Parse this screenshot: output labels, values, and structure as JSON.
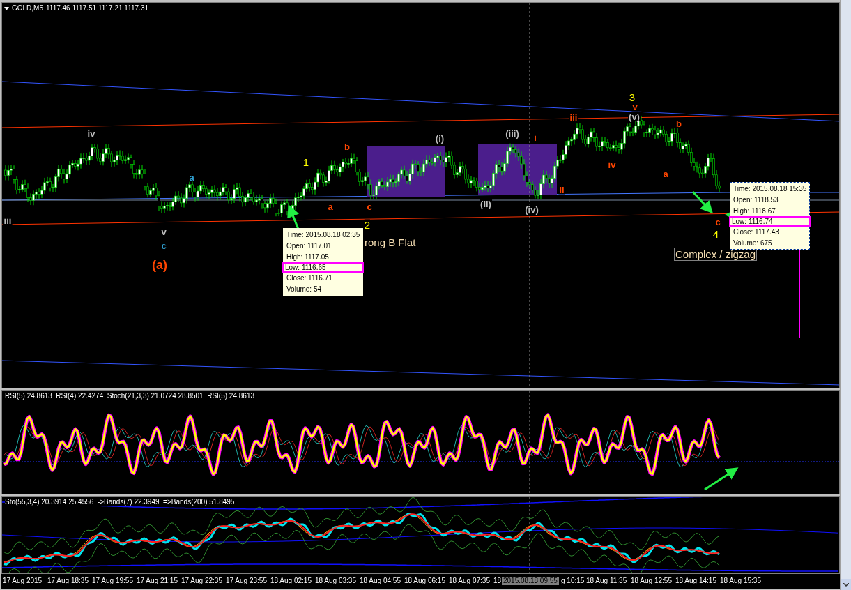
{
  "chart": {
    "symbol": "GOLD,M5",
    "ohlc": "1117.46 1117.51 1117.21 1117.31"
  },
  "wave_labels": [
    {
      "text": "iii",
      "color": "#c0c0c0",
      "kind": "minor"
    },
    {
      "text": "iv",
      "color": "#c0c0c0",
      "kind": "minor"
    },
    {
      "text": "a",
      "color": "#2f9fd0",
      "kind": "minor"
    },
    {
      "text": "v",
      "color": "#c0c0c0",
      "kind": "minor"
    },
    {
      "text": "c",
      "color": "#2f9fd0",
      "kind": "minor"
    },
    {
      "text": "(a)",
      "color": "#ff4500",
      "kind": "primary"
    },
    {
      "text": "1",
      "color": "#ffff00",
      "kind": "major"
    },
    {
      "text": "b",
      "color": "#ff4500",
      "kind": "minor"
    },
    {
      "text": "a",
      "color": "#ff4500",
      "kind": "minor"
    },
    {
      "text": "c",
      "color": "#ff4500",
      "kind": "minor"
    },
    {
      "text": "2",
      "color": "#ffff00",
      "kind": "major"
    },
    {
      "text": "(i)",
      "color": "#c0c0c0",
      "kind": "minor"
    },
    {
      "text": "(ii)",
      "color": "#c0c0c0",
      "kind": "minor"
    },
    {
      "text": "(iii)",
      "color": "#c0c0c0",
      "kind": "minor"
    },
    {
      "text": "(iv)",
      "color": "#c0c0c0",
      "kind": "minor"
    },
    {
      "text": "i",
      "color": "#ff4500",
      "kind": "minor"
    },
    {
      "text": "ii",
      "color": "#ff4500",
      "kind": "minor"
    },
    {
      "text": "iii",
      "color": "#ff4500",
      "kind": "minor"
    },
    {
      "text": "iv",
      "color": "#ff4500",
      "kind": "minor"
    },
    {
      "text": "3",
      "color": "#ffff00",
      "kind": "major"
    },
    {
      "text": "v",
      "color": "#ff4500",
      "kind": "minor"
    },
    {
      "text": "(v)",
      "color": "#c0c0c0",
      "kind": "minor"
    },
    {
      "text": "b",
      "color": "#ff4500",
      "kind": "minor"
    },
    {
      "text": "a",
      "color": "#ff4500",
      "kind": "minor"
    },
    {
      "text": "c",
      "color": "#ff4500",
      "kind": "minor"
    },
    {
      "text": "4",
      "color": "#ffff00",
      "kind": "major"
    }
  ],
  "note": "rong B Flat",
  "pattern_label": "Complex / zigzag",
  "tooltips": [
    {
      "lines": [
        {
          "text": "Time: 2015.08.18 02:35",
          "highlighted": false
        },
        {
          "text": "Open: 1117.01",
          "highlighted": false
        },
        {
          "text": "High: 1117.05",
          "highlighted": false
        },
        {
          "text": "Low: 1116.65",
          "highlighted": true
        },
        {
          "text": "Close: 1116.71",
          "highlighted": false
        },
        {
          "text": "Volume: 54",
          "highlighted": false
        }
      ],
      "selected": false
    },
    {
      "lines": [
        {
          "text": "Time: 2015.08.18 15:35",
          "highlighted": false
        },
        {
          "text": "Open: 1118.53",
          "highlighted": false
        },
        {
          "text": "High: 1118.67",
          "highlighted": false
        },
        {
          "text": "Low: 1116.74",
          "highlighted": true
        },
        {
          "text": "Close: 1117.43",
          "highlighted": false
        },
        {
          "text": "Volume: 675",
          "highlighted": false
        }
      ],
      "selected": true
    }
  ],
  "indicator_panels": [
    {
      "legend": "RSI(5) 24.8613  RSI(4) 22.4274  Stoch(21,3,3) 21.0724 28.8501  RSI(5) 24.8613",
      "kind": "rsi"
    },
    {
      "legend": "Sto(55,3,4) 20.3914 25.4556  ->Bands(7) 22.3949  =>Bands(200) 51.8495",
      "kind": "sto"
    }
  ],
  "time_axis": [
    {
      "label": "17 Aug 2015",
      "selected": false
    },
    {
      "label": "17 Aug 18:35",
      "selected": false
    },
    {
      "label": "17 Aug 19:55",
      "selected": false
    },
    {
      "label": "17 Aug 21:15",
      "selected": false
    },
    {
      "label": "17 Aug 22:35",
      "selected": false
    },
    {
      "label": "17 Aug 23:55",
      "selected": false
    },
    {
      "label": "18 Aug 02:15",
      "selected": false
    },
    {
      "label": "18 Aug 03:35",
      "selected": false
    },
    {
      "label": "18 Aug 04:55",
      "selected": false
    },
    {
      "label": "18 Aug 06:15",
      "selected": false
    },
    {
      "label": "18 Aug 07:35",
      "selected": false
    },
    {
      "label": "18",
      "selected": false
    },
    {
      "label": "2015.08.18 09:55",
      "selected": true
    },
    {
      "label": "g 10:15",
      "selected": false
    },
    {
      "label": "18 Aug 11:35",
      "selected": false
    },
    {
      "label": "18 Aug 12:55",
      "selected": false
    },
    {
      "label": "18 Aug 14:15",
      "selected": false
    },
    {
      "label": "18 Aug 15:35",
      "selected": false
    }
  ]
}
